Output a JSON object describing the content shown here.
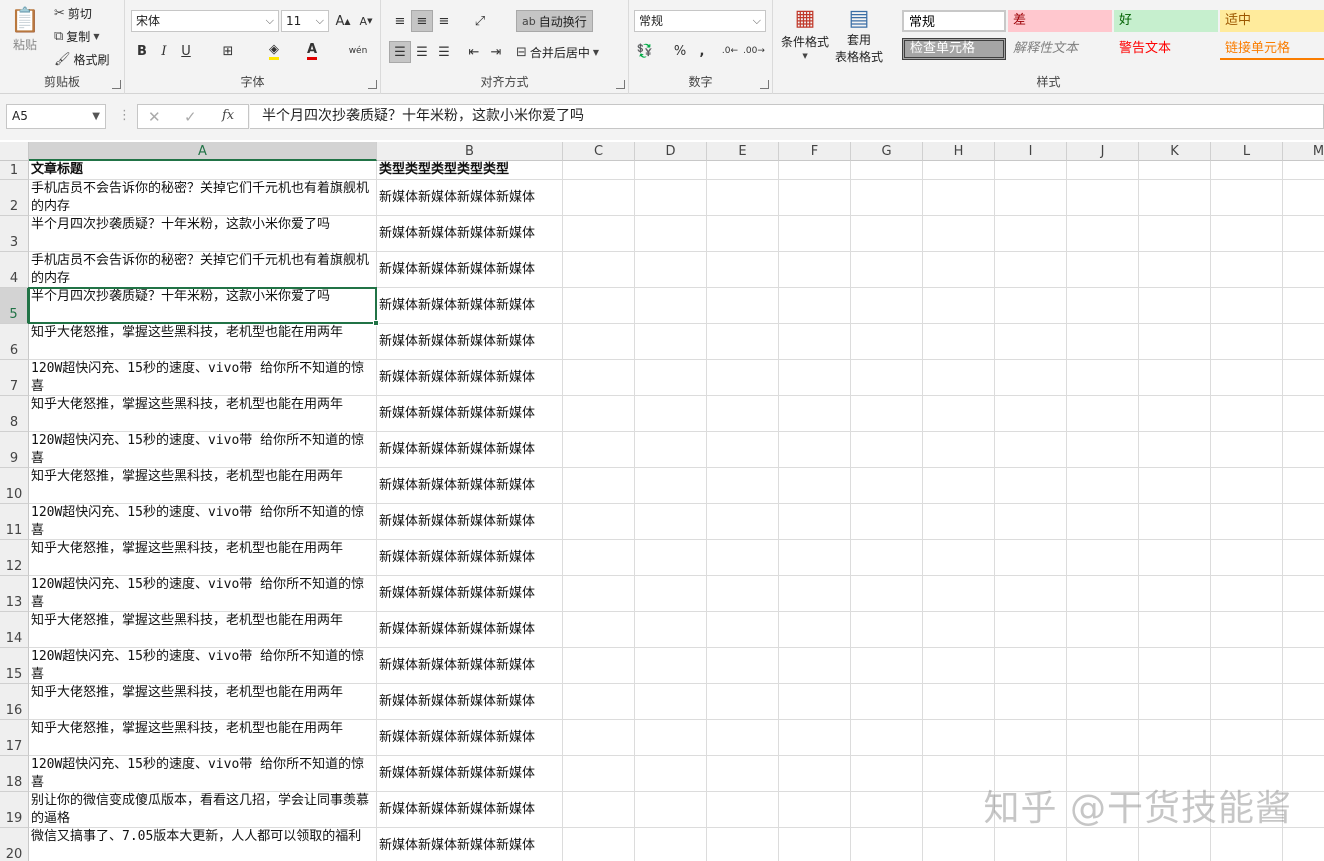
{
  "ribbon": {
    "clipboard": {
      "paste": "粘贴",
      "cut": "剪切",
      "copy": "复制",
      "format_painter": "格式刷",
      "label": "剪贴板"
    },
    "font": {
      "name": "宋体",
      "size": "11",
      "label": "字体",
      "bold": "B",
      "italic": "I",
      "underline": "U",
      "phonetic": "wén"
    },
    "alignment": {
      "wrap_text": "自动换行",
      "merge_center": "合并后居中",
      "label": "对齐方式"
    },
    "number": {
      "format": "常规",
      "percent": "%",
      "comma": ",",
      "label": "数字"
    },
    "styles": {
      "conditional_format": "条件格式",
      "table_format_line1": "套用",
      "table_format_line2": "表格格式",
      "cells": [
        {
          "label": "常规",
          "bg": "#ffffff",
          "color": "#000000"
        },
        {
          "label": "差",
          "bg": "#ffc7ce",
          "color": "#9c0006"
        },
        {
          "label": "好",
          "bg": "#c6efce",
          "color": "#006100"
        },
        {
          "label": "适中",
          "bg": "#ffeb9c",
          "color": "#9c5700"
        },
        {
          "label": "检查单元格",
          "bg": "#a5a5a5",
          "color": "#ffffff"
        },
        {
          "label": "解释性文本",
          "bg": "#f3f3f3",
          "color": "#7f7f7f"
        },
        {
          "label": "警告文本",
          "bg": "#f3f3f3",
          "color": "#ff0000"
        },
        {
          "label": "链接单元格",
          "bg": "#f3f3f3",
          "color": "#fa7d00"
        }
      ],
      "label": "样式"
    }
  },
  "formula_bar": {
    "name_box": "A5",
    "fx": "fx",
    "content": "半个月四次抄袭质疑？十年米粉，这款小米你爱了吗"
  },
  "columns": [
    "A",
    "B",
    "C",
    "D",
    "E",
    "F",
    "G",
    "H",
    "I",
    "J",
    "K",
    "L",
    "M"
  ],
  "rows": [
    {
      "num": "1",
      "a": "文章标题",
      "b": "类型类型类型类型类型"
    },
    {
      "num": "2",
      "a": "手机店员不会告诉你的秘密？关掉它们千元机也有着旗舰机的内存",
      "b": "新媒体新媒体新媒体新媒体"
    },
    {
      "num": "3",
      "a": "半个月四次抄袭质疑？十年米粉，这款小米你爱了吗",
      "b": "新媒体新媒体新媒体新媒体"
    },
    {
      "num": "4",
      "a": "手机店员不会告诉你的秘密？关掉它们千元机也有着旗舰机的内存",
      "b": "新媒体新媒体新媒体新媒体"
    },
    {
      "num": "5",
      "a": "半个月四次抄袭质疑？十年米粉，这款小米你爱了吗",
      "b": "新媒体新媒体新媒体新媒体"
    },
    {
      "num": "6",
      "a": "知乎大佬怒推，掌握这些黑科技，老机型也能在用两年",
      "b": "新媒体新媒体新媒体新媒体"
    },
    {
      "num": "7",
      "a": "120W超快闪充、15秒的速度、vivo带 给你所不知道的惊喜",
      "b": "新媒体新媒体新媒体新媒体"
    },
    {
      "num": "8",
      "a": "知乎大佬怒推，掌握这些黑科技，老机型也能在用两年",
      "b": "新媒体新媒体新媒体新媒体"
    },
    {
      "num": "9",
      "a": "120W超快闪充、15秒的速度、vivo带 给你所不知道的惊喜",
      "b": "新媒体新媒体新媒体新媒体"
    },
    {
      "num": "10",
      "a": "知乎大佬怒推，掌握这些黑科技，老机型也能在用两年",
      "b": "新媒体新媒体新媒体新媒体"
    },
    {
      "num": "11",
      "a": "120W超快闪充、15秒的速度、vivo带 给你所不知道的惊喜",
      "b": "新媒体新媒体新媒体新媒体"
    },
    {
      "num": "12",
      "a": "知乎大佬怒推，掌握这些黑科技，老机型也能在用两年",
      "b": "新媒体新媒体新媒体新媒体"
    },
    {
      "num": "13",
      "a": "120W超快闪充、15秒的速度、vivo带 给你所不知道的惊喜",
      "b": "新媒体新媒体新媒体新媒体"
    },
    {
      "num": "14",
      "a": "知乎大佬怒推，掌握这些黑科技，老机型也能在用两年",
      "b": "新媒体新媒体新媒体新媒体"
    },
    {
      "num": "15",
      "a": "120W超快闪充、15秒的速度、vivo带 给你所不知道的惊喜",
      "b": "新媒体新媒体新媒体新媒体"
    },
    {
      "num": "16",
      "a": "知乎大佬怒推，掌握这些黑科技，老机型也能在用两年",
      "b": "新媒体新媒体新媒体新媒体"
    },
    {
      "num": "17",
      "a": "知乎大佬怒推，掌握这些黑科技，老机型也能在用两年",
      "b": "新媒体新媒体新媒体新媒体"
    },
    {
      "num": "18",
      "a": "120W超快闪充、15秒的速度、vivo带 给你所不知道的惊喜",
      "b": "新媒体新媒体新媒体新媒体"
    },
    {
      "num": "19",
      "a": "别让你的微信变成傻瓜版本，看看这几招，学会让同事羡慕的逼格",
      "b": "新媒体新媒体新媒体新媒体"
    },
    {
      "num": "20",
      "a": "微信又搞事了、7.05版本大更新，人人都可以领取的福利",
      "b": "新媒体新媒体新媒体新媒体"
    }
  ],
  "selected_cell": {
    "col": "A",
    "row": "5"
  },
  "watermark": "知乎 @干货技能酱"
}
